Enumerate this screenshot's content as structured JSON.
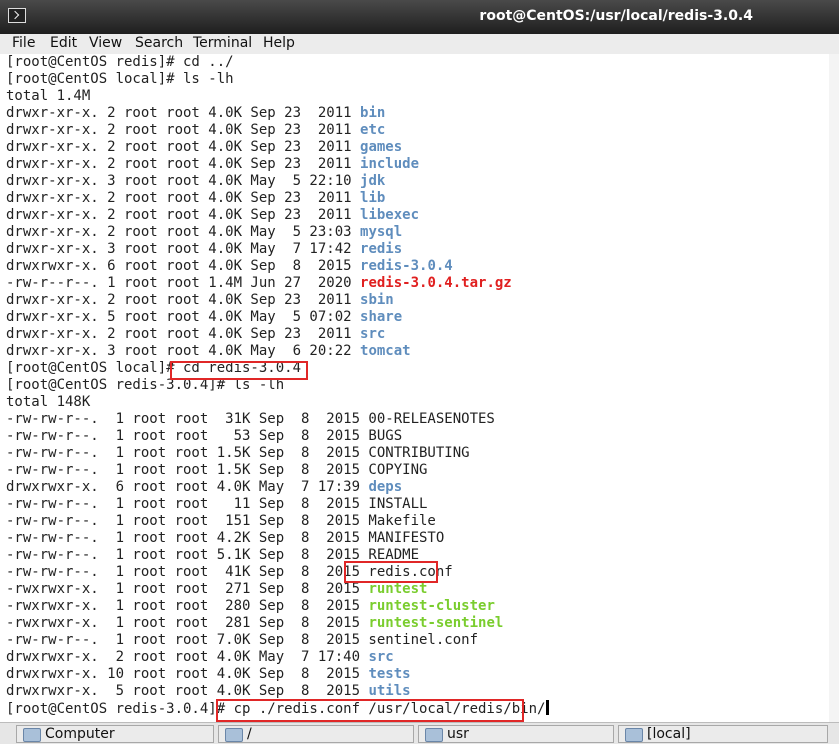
{
  "window": {
    "title": "root@CentOS:/usr/local/redis-3.0.4"
  },
  "menu": [
    "File",
    "Edit",
    "View",
    "Search",
    "Terminal",
    "Help"
  ],
  "terminal_lines": [
    [
      {
        "t": "[root@CentOS redis]# cd ../"
      }
    ],
    [
      {
        "t": "[root@CentOS local]# ls -lh"
      }
    ],
    [
      {
        "t": "total 1.4M"
      }
    ],
    [
      {
        "t": "drwxr-xr-x. 2 root root 4.0K Sep 23  2011 "
      },
      {
        "t": "bin",
        "c": "blue"
      }
    ],
    [
      {
        "t": "drwxr-xr-x. 2 root root 4.0K Sep 23  2011 "
      },
      {
        "t": "etc",
        "c": "blue"
      }
    ],
    [
      {
        "t": "drwxr-xr-x. 2 root root 4.0K Sep 23  2011 "
      },
      {
        "t": "games",
        "c": "blue"
      }
    ],
    [
      {
        "t": "drwxr-xr-x. 2 root root 4.0K Sep 23  2011 "
      },
      {
        "t": "include",
        "c": "blue"
      }
    ],
    [
      {
        "t": "drwxr-xr-x. 3 root root 4.0K May  5 22:10 "
      },
      {
        "t": "jdk",
        "c": "blue"
      }
    ],
    [
      {
        "t": "drwxr-xr-x. 2 root root 4.0K Sep 23  2011 "
      },
      {
        "t": "lib",
        "c": "blue"
      }
    ],
    [
      {
        "t": "drwxr-xr-x. 2 root root 4.0K Sep 23  2011 "
      },
      {
        "t": "libexec",
        "c": "blue"
      }
    ],
    [
      {
        "t": "drwxr-xr-x. 2 root root 4.0K May  5 23:03 "
      },
      {
        "t": "mysql",
        "c": "blue"
      }
    ],
    [
      {
        "t": "drwxr-xr-x. 3 root root 4.0K May  7 17:42 "
      },
      {
        "t": "redis",
        "c": "blue"
      }
    ],
    [
      {
        "t": "drwxrwxr-x. 6 root root 4.0K Sep  8  2015 "
      },
      {
        "t": "redis-3.0.4",
        "c": "blue"
      }
    ],
    [
      {
        "t": "-rw-r--r--. 1 root root 1.4M Jun 27  2020 "
      },
      {
        "t": "redis-3.0.4.tar.gz",
        "c": "red"
      }
    ],
    [
      {
        "t": "drwxr-xr-x. 2 root root 4.0K Sep 23  2011 "
      },
      {
        "t": "sbin",
        "c": "blue"
      }
    ],
    [
      {
        "t": "drwxr-xr-x. 5 root root 4.0K May  5 07:02 "
      },
      {
        "t": "share",
        "c": "blue"
      }
    ],
    [
      {
        "t": "drwxr-xr-x. 2 root root 4.0K Sep 23  2011 "
      },
      {
        "t": "src",
        "c": "blue"
      }
    ],
    [
      {
        "t": "drwxr-xr-x. 3 root root 4.0K May  6 20:22 "
      },
      {
        "t": "tomcat",
        "c": "blue"
      }
    ],
    [
      {
        "t": "[root@CentOS local]# cd redis-3.0.4"
      }
    ],
    [
      {
        "t": "[root@CentOS redis-3.0.4]# ls -lh"
      }
    ],
    [
      {
        "t": "total 148K"
      }
    ],
    [
      {
        "t": "-rw-rw-r--.  1 root root  31K Sep  8  2015 00-RELEASENOTES"
      }
    ],
    [
      {
        "t": "-rw-rw-r--.  1 root root   53 Sep  8  2015 BUGS"
      }
    ],
    [
      {
        "t": "-rw-rw-r--.  1 root root 1.5K Sep  8  2015 CONTRIBUTING"
      }
    ],
    [
      {
        "t": "-rw-rw-r--.  1 root root 1.5K Sep  8  2015 COPYING"
      }
    ],
    [
      {
        "t": "drwxrwxr-x.  6 root root 4.0K May  7 17:39 "
      },
      {
        "t": "deps",
        "c": "blue"
      }
    ],
    [
      {
        "t": "-rw-rw-r--.  1 root root   11 Sep  8  2015 INSTALL"
      }
    ],
    [
      {
        "t": "-rw-rw-r--.  1 root root  151 Sep  8  2015 Makefile"
      }
    ],
    [
      {
        "t": "-rw-rw-r--.  1 root root 4.2K Sep  8  2015 MANIFESTO"
      }
    ],
    [
      {
        "t": "-rw-rw-r--.  1 root root 5.1K Sep  8  2015 README"
      }
    ],
    [
      {
        "t": "-rw-rw-r--.  1 root root  41K Sep  8  2015 redis.conf"
      }
    ],
    [
      {
        "t": "-rwxrwxr-x.  1 root root  271 Sep  8  2015 "
      },
      {
        "t": "runtest",
        "c": "green"
      }
    ],
    [
      {
        "t": "-rwxrwxr-x.  1 root root  280 Sep  8  2015 "
      },
      {
        "t": "runtest-cluster",
        "c": "green"
      }
    ],
    [
      {
        "t": "-rwxrwxr-x.  1 root root  281 Sep  8  2015 "
      },
      {
        "t": "runtest-sentinel",
        "c": "green"
      }
    ],
    [
      {
        "t": "-rw-rw-r--.  1 root root 7.0K Sep  8  2015 sentinel.conf"
      }
    ],
    [
      {
        "t": "drwxrwxr-x.  2 root root 4.0K May  7 17:40 "
      },
      {
        "t": "src",
        "c": "blue"
      }
    ],
    [
      {
        "t": "drwxrwxr-x. 10 root root 4.0K Sep  8  2015 "
      },
      {
        "t": "tests",
        "c": "blue"
      }
    ],
    [
      {
        "t": "drwxrwxr-x.  5 root root 4.0K Sep  8  2015 "
      },
      {
        "t": "utils",
        "c": "blue"
      }
    ],
    [
      {
        "t": "[root@CentOS redis-3.0.4]# cp ./redis.conf /usr/local/redis/bin/"
      }
    ]
  ],
  "taskbar": [
    {
      "label": "Computer",
      "icon": "computer-icon"
    },
    {
      "label": "/",
      "icon": "folder-icon"
    },
    {
      "label": "usr",
      "icon": "folder-icon"
    },
    {
      "label": "[local]",
      "icon": "folder-icon"
    }
  ],
  "colors": {
    "dir": "#5f8dbd",
    "archive": "#e02020",
    "exec": "#7acd2e",
    "highlight": "#e02727"
  }
}
